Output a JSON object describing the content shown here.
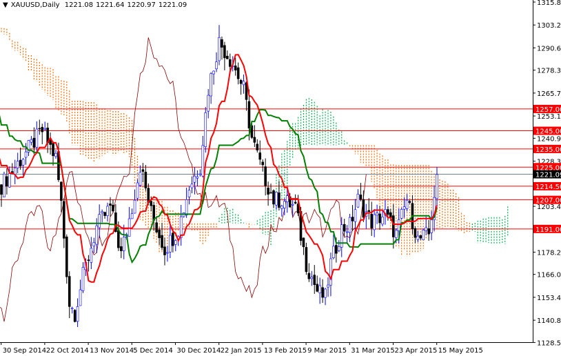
{
  "header": {
    "arrow": "▼",
    "symbol": "XAUUSD,Daily",
    "open": "1221.08",
    "high": "1221.64",
    "low": "1220.97",
    "close": "1221.09"
  },
  "chart_data": {
    "type": "candlestick",
    "title": "XAUUSD,Daily",
    "indicator": "Ichimoku Kinko Hyo (9,26,52)",
    "ylim": [
      1128.55,
      1315.8
    ],
    "y_ticks": [
      "1315.80",
      "1303.20",
      "1290.60",
      "1278.35",
      "1265.75",
      "1253.15",
      "1240.90",
      "1228.30",
      "1215.70",
      "1203.45",
      "1178.25",
      "1166.00",
      "1153.40",
      "1140.80",
      "1128.55"
    ],
    "x_ticks": [
      {
        "label": "30 Sep 2014",
        "bar": 6
      },
      {
        "label": "22 Oct 2014",
        "bar": 22
      },
      {
        "label": "13 Nov 2014",
        "bar": 38
      },
      {
        "label": "5 Dec 2014",
        "bar": 54
      },
      {
        "label": "30 Dec 2014",
        "bar": 70
      },
      {
        "label": "22 Jan 2015",
        "bar": 86
      },
      {
        "label": "13 Feb 2015",
        "bar": 102
      },
      {
        "label": "9 Mar 2015",
        "bar": 118
      },
      {
        "label": "31 Mar 2015",
        "bar": 134
      },
      {
        "label": "23 Apr 2015",
        "bar": 150
      },
      {
        "label": "15 May 2015",
        "bar": 166
      }
    ],
    "levels": [
      {
        "price": 1257.0,
        "label": "1257.00"
      },
      {
        "price": 1245.0,
        "label": "1245.00"
      },
      {
        "price": 1235.0,
        "label": "1235.00"
      },
      {
        "price": 1225.0,
        "label": "1225.00"
      },
      {
        "price": 1214.5,
        "label": "1214.50"
      },
      {
        "price": 1207.0,
        "label": "1207.00"
      },
      {
        "price": 1191.0,
        "label": "1191.00"
      }
    ],
    "current_price": {
      "price": 1221.09,
      "label": "1221.09"
    },
    "close_anchors": [
      [
        -80,
        1290
      ],
      [
        -70,
        1300
      ],
      [
        -60,
        1305
      ],
      [
        -45,
        1312
      ],
      [
        -30,
        1295
      ],
      [
        -15,
        1262
      ],
      [
        -5,
        1235
      ],
      [
        0,
        1215
      ],
      [
        5,
        1225
      ],
      [
        10,
        1235
      ],
      [
        15,
        1245
      ],
      [
        20,
        1230
      ],
      [
        22,
        1205
      ],
      [
        25,
        1150
      ],
      [
        27,
        1145
      ],
      [
        30,
        1165
      ],
      [
        35,
        1192
      ],
      [
        40,
        1203
      ],
      [
        44,
        1177
      ],
      [
        48,
        1203
      ],
      [
        51,
        1226
      ],
      [
        55,
        1200
      ],
      [
        60,
        1180
      ],
      [
        65,
        1191
      ],
      [
        69,
        1214
      ],
      [
        73,
        1226
      ],
      [
        76,
        1268
      ],
      [
        80,
        1294
      ],
      [
        85,
        1282
      ],
      [
        89,
        1268
      ],
      [
        92,
        1241
      ],
      [
        96,
        1222
      ],
      [
        100,
        1207
      ],
      [
        103,
        1207
      ],
      [
        108,
        1203
      ],
      [
        112,
        1172
      ],
      [
        116,
        1157
      ],
      [
        119,
        1153
      ],
      [
        121,
        1172
      ],
      [
        125,
        1191
      ],
      [
        128,
        1193
      ],
      [
        131,
        1207
      ],
      [
        136,
        1195
      ],
      [
        141,
        1199
      ],
      [
        145,
        1188
      ],
      [
        149,
        1207
      ],
      [
        153,
        1185
      ],
      [
        157,
        1188
      ],
      [
        160,
        1221
      ]
    ],
    "colors": {
      "tenkan": "#ff0000",
      "kijun": "#008000",
      "chikou": "#8b0000",
      "cloud_bear": "#ff6a00",
      "cloud_bull": "#00b050",
      "level": "#ff0000",
      "bull": "#0000ff",
      "bear": "#000000"
    }
  }
}
